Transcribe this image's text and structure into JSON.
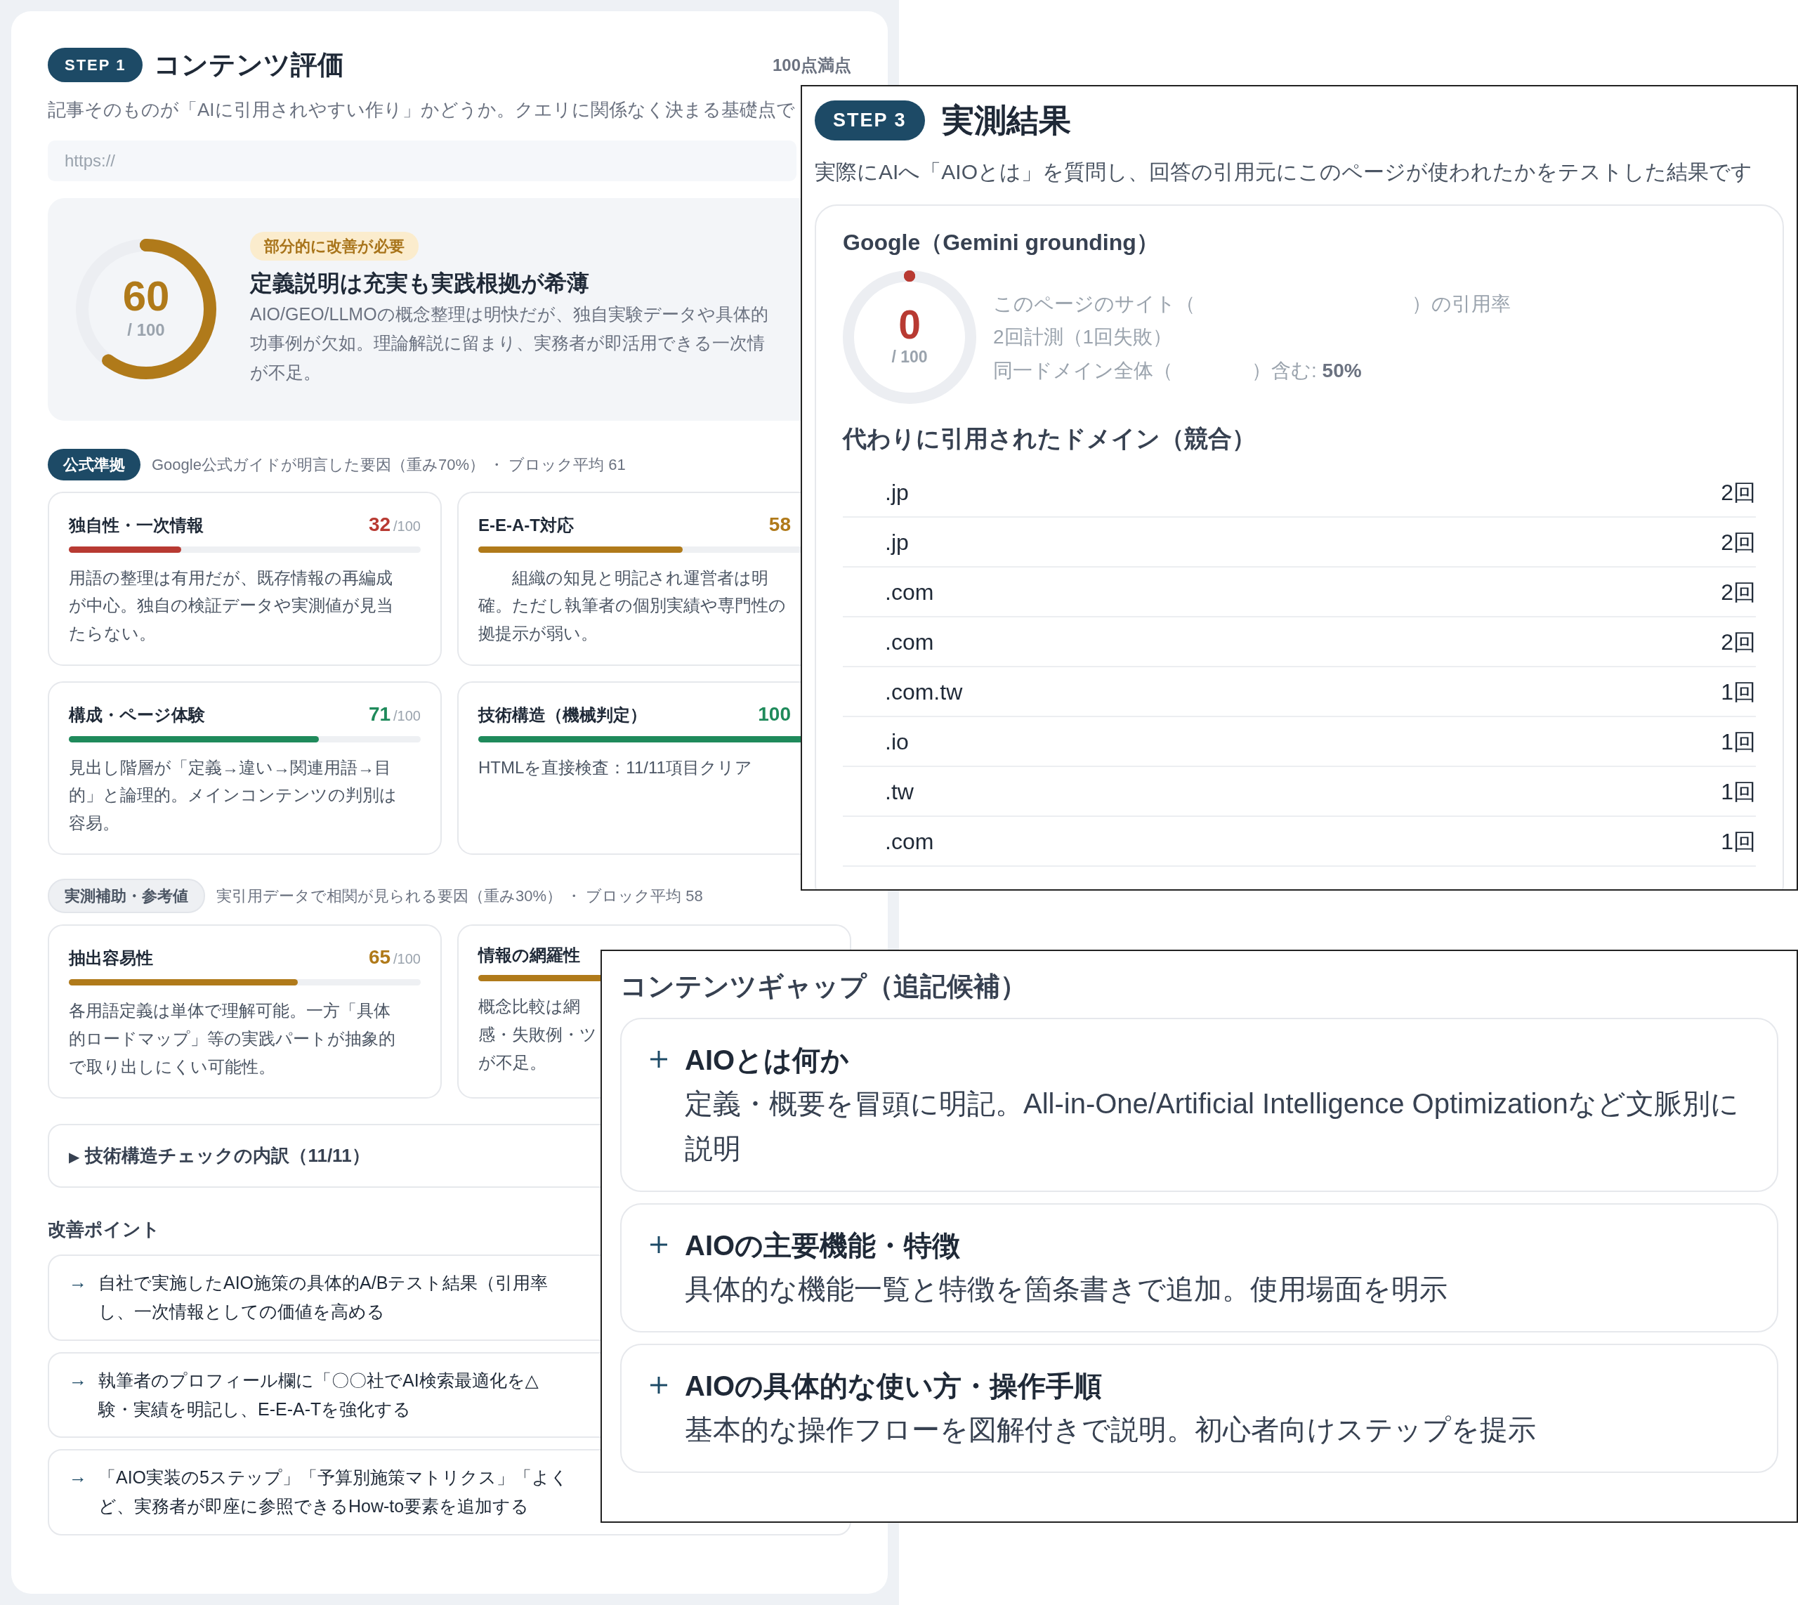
{
  "step1": {
    "badge": "STEP 1",
    "title": "コンテンツ評価",
    "max_note": "100点満点",
    "description": "記事そのものが「AIに引用されやすい作り」かどうか。クエリに関係なく決まる基礎点で",
    "url_field": {
      "placeholder": "https://"
    },
    "score": {
      "value": "60",
      "unit": "/ 100",
      "level": 0.6,
      "color": "#b07a1a",
      "status": "部分的に改善が必要",
      "headline": "定義説明は充実も実践根拠が希薄",
      "lines": [
        "AIO/GEO/LLMOの概念整理は明快だが、独自実験データや具体的",
        "功事例が欠如。理論解説に留まり、実務者が即活用できる一次情",
        "が不足。"
      ]
    },
    "blocks": [
      {
        "kind": "primary",
        "badge": "公式準拠",
        "caption": "Google公式ガイドが明言した要因（重み70%） ・ ブロック平均 61",
        "metrics": [
          {
            "name": "独自性・一次情報",
            "score": "32",
            "unit": "/100",
            "color": "#b83a32",
            "level": 0.32,
            "lines": [
              "用語の整理は有用だが、既存情報の再編成",
              "が中心。独自の検証データや実測値が見当",
              "たらない。"
            ]
          },
          {
            "name": "E-E-A-T対応",
            "score": "58",
            "color": "#b07a1a",
            "level": 0.58,
            "lines": [
              "　　組織の知見と明記され運営者は明",
              "確。ただし執筆者の個別実績や専門性の",
              "拠提示が弱い。"
            ]
          },
          {
            "name": "構成・ページ体験",
            "score": "71",
            "unit": "/100",
            "color": "#1f8a5b",
            "level": 0.71,
            "lines": [
              "見出し階層が「定義→違い→関連用語→目",
              "的」と論理的。メインコンテンツの判別は",
              "容易。"
            ]
          },
          {
            "name": "技術構造（機械判定）",
            "score": "100",
            "color": "#1f8a5b",
            "level": 1,
            "lines": [
              "HTMLを直接検査：11/11項目クリア"
            ]
          }
        ]
      },
      {
        "kind": "secondary",
        "badge": "実測補助・参考値",
        "caption": "実引用データで相関が見られる要因（重み30%） ・ ブロック平均 58",
        "metrics": [
          {
            "name": "抽出容易性",
            "score": "65",
            "unit": "/100",
            "color": "#b07a1a",
            "level": 0.65,
            "lines": [
              "各用語定義は単体で理解可能。一方「具体",
              "的ロードマップ」等の実践パートが抽象的",
              "で取り出しにくい可能性。"
            ]
          },
          {
            "name": "情報の網羅性",
            "color": "#b07a1a",
            "level": 0.6,
            "lines": [
              "概念比較は網",
              "感・失敗例・ツ",
              "が不足。"
            ]
          }
        ]
      }
    ],
    "details": {
      "marker": "▶",
      "label": "技術構造チェックの内訳（11/11）",
      "expanded": false
    },
    "improvements": {
      "title": "改善ポイント",
      "items": [
        {
          "arrow": "→",
          "lines": [
            "自社で実施したAIO施策の具体的A/Bテスト結果（引用率",
            "し、一次情報としての価値を高める"
          ]
        },
        {
          "arrow": "→",
          "lines": [
            "執筆者のプロフィール欄に「〇〇社でAI検索最適化を△",
            "験・実績を明記し、E-E-A-Tを強化する"
          ]
        },
        {
          "arrow": "→",
          "lines": [
            "「AIO実装の5ステップ」「予算別施策マトリクス」「よく",
            "ど、実務者が即座に参照できるHow-to要素を追加する"
          ]
        }
      ]
    }
  },
  "step3": {
    "badge": "STEP 3",
    "title": "実測結果",
    "description": "実際にAIへ「AIOとは」を質問し、回答の引用元にこのページが使われたかをテストした結果です",
    "engine": {
      "name": "Google（Gemini grounding）",
      "score": {
        "value": "0",
        "unit": "/ 100",
        "level": 0,
        "color": "#b83a32"
      },
      "stats": [
        "このページのサイト（　　　　　　　　　　　）の引用率",
        "2回計測（1回失敗）",
        "同一ドメイン全体（　　　　）含む: **50%**"
      ],
      "competitors": {
        "title": "代わりに引用されたドメイン（競合）",
        "rows": [
          {
            "domain": ".jp",
            "count": "2回"
          },
          {
            "domain": ".jp",
            "count": "2回"
          },
          {
            "domain": ".com",
            "count": "2回"
          },
          {
            "domain": ".com",
            "count": "2回"
          },
          {
            "domain": ".com.tw",
            "count": "1回"
          },
          {
            "domain": ".io",
            "count": "1回"
          },
          {
            "domain": ".tw",
            "count": "1回"
          },
          {
            "domain": ".com",
            "count": "1回"
          }
        ]
      }
    }
  },
  "content_gap": {
    "title": "コンテンツギャップ（追記候補）",
    "items": [
      {
        "title": "AIOとは何か",
        "text": "定義・概要を冒頭に明記。All-in-One/Artificial Intelligence Optimizationなど文脈別に説明"
      },
      {
        "title": "AIOの主要機能・特徴",
        "text": "具体的な機能一覧と特徴を箇条書きで追加。使用場面を明示"
      },
      {
        "title": "AIOの具体的な使い方・操作手順",
        "text": "基本的な操作フローを図解付きで説明。初心者向けステップを提示"
      }
    ]
  }
}
